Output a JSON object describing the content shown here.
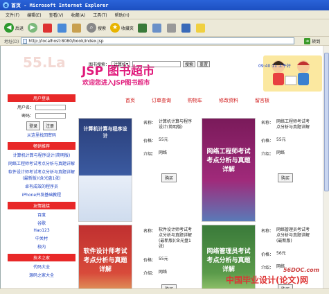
{
  "window": {
    "title": "首页 - Microsoft Internet Explorer",
    "ie_icon": "e"
  },
  "menu": [
    "文件(F)",
    "编辑(E)",
    "查看(V)",
    "收藏(A)",
    "工具(T)",
    "帮助(H)"
  ],
  "toolbar": {
    "back": "后退",
    "search": "搜索",
    "favorites": "收藏夹"
  },
  "address": {
    "label": "地址(D)",
    "url": "http://localhost:8080/book/index.jsp",
    "go": "转到"
  },
  "banner": {
    "bg_text": "55.La",
    "logo": "JSP 图书超市",
    "welcome": "欢迎您进入JSP图书超市"
  },
  "nav": [
    "首页",
    "订单查询",
    "购物车",
    "修改资料",
    "留言板"
  ],
  "login": {
    "title": "用户登录",
    "username": "用户名：",
    "password": "密码：",
    "login_btn": "登录",
    "register_btn": "注册",
    "forgot": "从这里找回密码"
  },
  "recommend": {
    "title": "畅销推荐",
    "items": [
      "计算机计算与程序设计(简明版)",
      "网络工程师考试考点分析与真题详解",
      "软件设计师考试考点分析与真题详解(最新版)(含光盘1张)",
      "卓有成效的程序员",
      "iPhone开发基础教程"
    ]
  },
  "links": {
    "title": "友情链接",
    "items": [
      "百度",
      "谷歌",
      "Hao123",
      "中关村",
      "校内"
    ]
  },
  "tech": {
    "title": "技术之家",
    "items": [
      "代码大全",
      "源码之家大全"
    ]
  },
  "search": {
    "label": "图书搜索：",
    "select": "计算机",
    "btn1": "搜索",
    "btn2": "重置"
  },
  "clock": "09:40:11 上午好",
  "labels": {
    "name": "名称：",
    "price": "价格：",
    "intro": "介绍：",
    "buy": "购买"
  },
  "books": [
    {
      "name": "计算机计算与程序设计(简明版)",
      "price": "55元",
      "intro": "网络",
      "cover_title": "计算机计算与程序设计"
    },
    {
      "name": "网络工程师考试考点分析与真题详解",
      "price": "55元",
      "intro": "网络",
      "cover_title": "网络工程师考试考点分析与真题详解"
    },
    {
      "name": "软件设计师考试考点分析与真题详解(最新版)(含光盘1张)",
      "price": "55元",
      "intro": "网络",
      "cover_title": "软件设计师考试考点分析与真题详解"
    },
    {
      "name": "网络管理员考试考点分析与真题详解(最新版)",
      "price": "56元",
      "intro": "网络",
      "cover_title": "网络管理员考试考点分析与真题详解"
    },
    {
      "name": "程序员考试考点分析与真题详解",
      "price": "",
      "intro": "",
      "cover_title": ""
    }
  ],
  "watermark": {
    "site": "56DOC.com",
    "text": "中国毕业设计(论文)网"
  }
}
